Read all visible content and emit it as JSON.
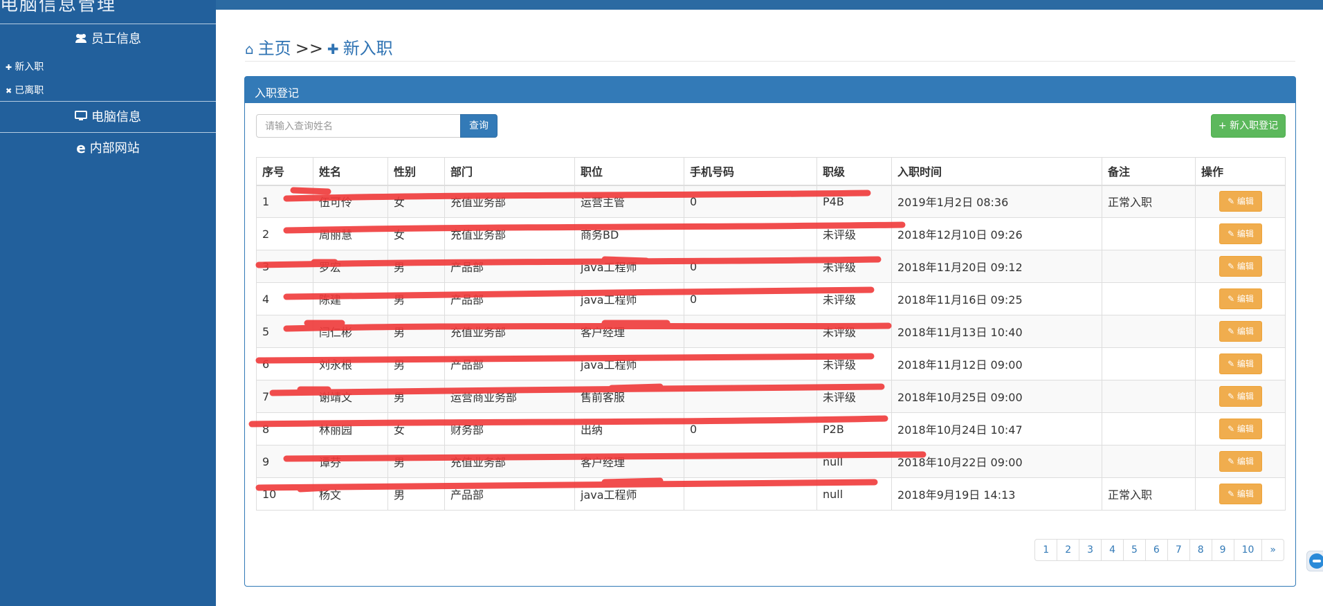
{
  "app": {
    "title": "电脑信息管理"
  },
  "sidebar": {
    "sections": [
      {
        "label": "员工信息",
        "icon": "users-icon"
      },
      {
        "label": "电脑信息",
        "icon": "monitor-icon"
      },
      {
        "label": "内部网站",
        "icon": "ie-icon"
      }
    ],
    "items": [
      {
        "label": "新入职",
        "icon": "user-plus-icon"
      },
      {
        "label": "已离职",
        "icon": "user-times-icon"
      }
    ]
  },
  "breadcrumb": {
    "home": "主页",
    "separator": ">>",
    "current": "新入职"
  },
  "panel": {
    "title": "入职登记",
    "search_placeholder": "请输入查询姓名",
    "search_button": "查询",
    "add_button": "+ 新入职登记"
  },
  "table": {
    "headers": [
      "序号",
      "姓名",
      "性别",
      "部门",
      "职位",
      "手机号码",
      "职级",
      "入职时间",
      "备注",
      "操作"
    ],
    "rows": [
      {
        "no": "1",
        "name": "伍可伶",
        "gender": "女",
        "dept": "充值业务部",
        "position": "运营主管",
        "phone": "0",
        "grade": "P4B",
        "date": "2019年1月2日 08:36",
        "note": "正常入职"
      },
      {
        "no": "2",
        "name": "周丽慧",
        "gender": "女",
        "dept": "充值业务部",
        "position": "商务BD",
        "phone": "",
        "grade": "未评级",
        "date": "2018年12月10日 09:26",
        "note": ""
      },
      {
        "no": "3",
        "name": "罗宏",
        "gender": "男",
        "dept": "产品部",
        "position": "java工程师",
        "phone": "0",
        "grade": "未评级",
        "date": "2018年11月20日 09:12",
        "note": ""
      },
      {
        "no": "4",
        "name": "陈建",
        "gender": "男",
        "dept": "产品部",
        "position": "java工程师",
        "phone": "0",
        "grade": "未评级",
        "date": "2018年11月16日 09:25",
        "note": ""
      },
      {
        "no": "5",
        "name": "闫仁彬",
        "gender": "男",
        "dept": "充值业务部",
        "position": "客户经理",
        "phone": "",
        "grade": "未评级",
        "date": "2018年11月13日 10:40",
        "note": ""
      },
      {
        "no": "6",
        "name": "刘永根",
        "gender": "男",
        "dept": "产品部",
        "position": "java工程师",
        "phone": "",
        "grade": "未评级",
        "date": "2018年11月12日 09:00",
        "note": ""
      },
      {
        "no": "7",
        "name": "谢靖文",
        "gender": "男",
        "dept": "运营商业务部",
        "position": "售前客服",
        "phone": "",
        "grade": "未评级",
        "date": "2018年10月25日 09:00",
        "note": ""
      },
      {
        "no": "8",
        "name": "林丽园",
        "gender": "女",
        "dept": "财务部",
        "position": "出纳",
        "phone": "0",
        "grade": "P2B",
        "date": "2018年10月24日 10:47",
        "note": ""
      },
      {
        "no": "9",
        "name": "谭芬",
        "gender": "男",
        "dept": "充值业务部",
        "position": "客户经理",
        "phone": "",
        "grade": "null",
        "date": "2018年10月22日 09:00",
        "note": ""
      },
      {
        "no": "10",
        "name": "杨文",
        "gender": "男",
        "dept": "产品部",
        "position": "java工程师",
        "phone": "",
        "grade": "null",
        "date": "2018年9月19日 14:13",
        "note": "正常入职"
      }
    ],
    "edit_label": "✎ 编辑"
  },
  "pagination": [
    "1",
    "2",
    "3",
    "4",
    "5",
    "6",
    "7",
    "8",
    "9",
    "10",
    "»"
  ],
  "colors": {
    "sidebar": "#22609c",
    "primary": "#337ab7",
    "success": "#5cb85c",
    "warning": "#f0ad4e",
    "redaction": "#f03a3a"
  }
}
